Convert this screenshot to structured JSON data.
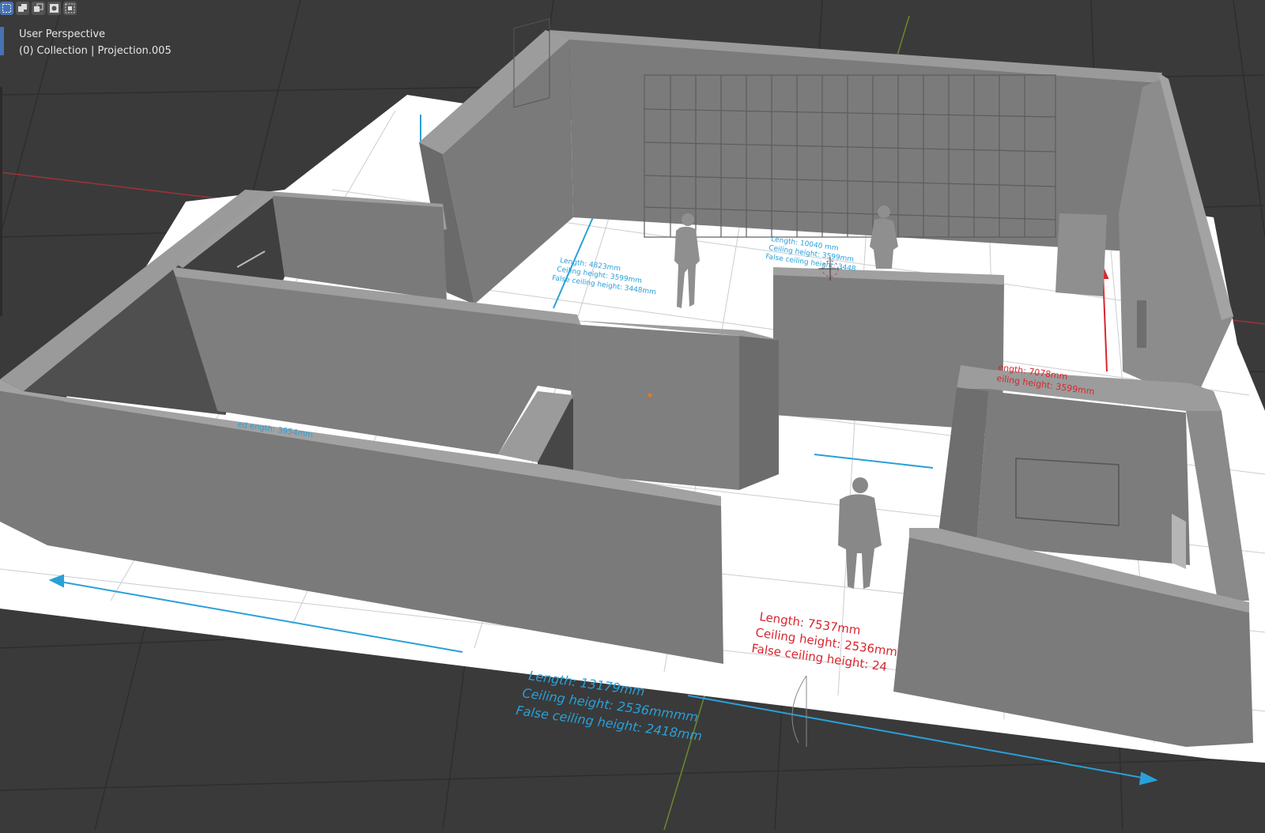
{
  "viewport": {
    "view_name": "User Perspective",
    "collection_info": "(0) Collection | Projection.005"
  },
  "toolbar": {
    "buttons": [
      {
        "icon": "select-box-icon",
        "active": true
      },
      {
        "icon": "select-extend-icon",
        "active": false
      },
      {
        "icon": "select-subtract-icon",
        "active": false
      },
      {
        "icon": "select-invert-icon",
        "active": false
      },
      {
        "icon": "select-intersect-icon",
        "active": false
      }
    ]
  },
  "annotations": {
    "main_room": {
      "length": "Length: 13179mm",
      "ceiling": "Ceiling height: 2536mmmm",
      "false_ceiling": "False ceiling height: 2418mm"
    },
    "corridor": {
      "length": "Length: 7537mm",
      "ceiling": "Ceiling height: 2536mm",
      "false_ceiling": "False ceiling height: 24"
    },
    "right_room": {
      "length": "ength: 7078mm",
      "ceiling": "eiling height: 3599mm"
    },
    "back_room": {
      "length": "Length: 10040 mm",
      "ceiling": "Ceiling height: 3599mm",
      "false_ceiling": "False ceiling height: 3448"
    },
    "left_room": {
      "length": "Length: 4823mm",
      "ceiling": "Ceiling height: 3599mm",
      "false_ceiling": "False ceiling height: 3448mm"
    },
    "inner_room": {
      "length": "ed ength: 3954mm"
    }
  },
  "colors": {
    "background": "#3a3a3a",
    "grid": "#2e2e2e",
    "floor": "#ffffff",
    "wall_top": "#9a9a9a",
    "wall_front": "#7d7d7d",
    "wall_dark": "#5a5a5a",
    "blue_dim": "#2aa0d8",
    "red_dim": "#d8262e",
    "accent": "#4772b3"
  }
}
